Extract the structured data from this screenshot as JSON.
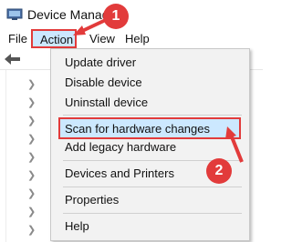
{
  "window": {
    "title": "Device Manager"
  },
  "menubar": {
    "file": "File",
    "action": "Action",
    "view": "View",
    "help": "Help"
  },
  "action_menu": {
    "update_driver": "Update driver",
    "disable_device": "Disable device",
    "uninstall_device": "Uninstall device",
    "scan_hardware": "Scan for hardware changes",
    "add_legacy": "Add legacy hardware",
    "devices_printers": "Devices and Printers",
    "properties": "Properties",
    "help": "Help"
  },
  "annotations": {
    "step1": "1",
    "step2": "2",
    "accent_color": "#e23b3b",
    "highlight_color": "#cce8ff"
  }
}
